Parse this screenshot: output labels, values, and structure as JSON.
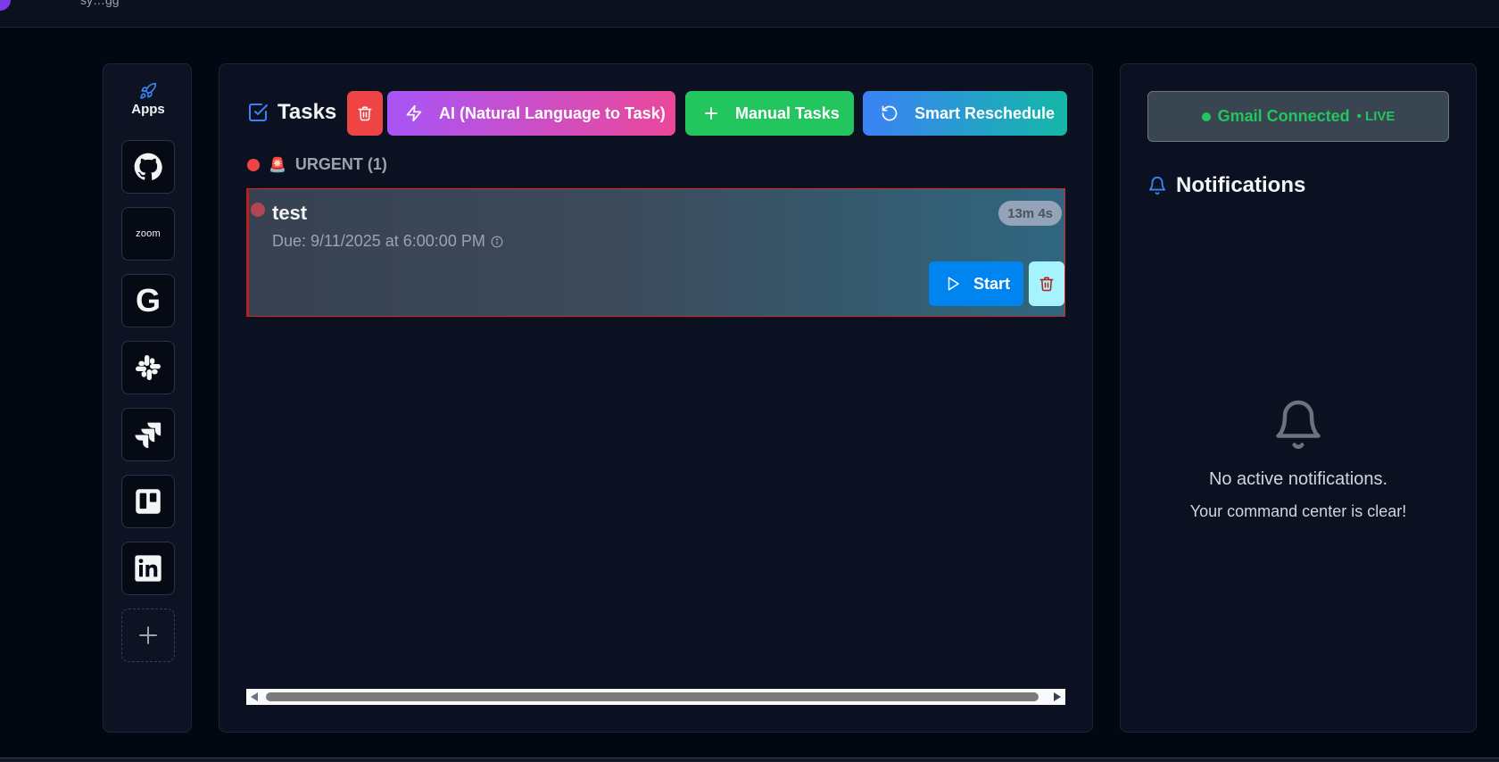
{
  "topbar": {
    "user_text": "sy…gg"
  },
  "sidebar": {
    "header_label": "Apps",
    "apps": [
      {
        "name": "github",
        "icon": "github-icon"
      },
      {
        "name": "zoom",
        "icon": "zoom-icon",
        "text": "zoom"
      },
      {
        "name": "google",
        "icon": "google-icon",
        "text": "G"
      },
      {
        "name": "slack",
        "icon": "slack-icon"
      },
      {
        "name": "jira",
        "icon": "jira-icon"
      },
      {
        "name": "trello",
        "icon": "trello-icon"
      },
      {
        "name": "linkedin",
        "icon": "linkedin-icon"
      }
    ],
    "add_icon": "plus-icon"
  },
  "tasks": {
    "title": "Tasks",
    "buttons": {
      "ai_label": "AI (Natural Language to Task)",
      "manual_label": "Manual Tasks",
      "smart_label": "Smart Reschedule"
    },
    "group": {
      "label": "URGENT (1)",
      "emoji": "🚨",
      "color": "#ef4444"
    },
    "items": [
      {
        "title": "test",
        "due": "Due: 9/11/2025 at 6:00:00 PM",
        "timer": "13m 4s",
        "start_label": "Start"
      }
    ]
  },
  "right": {
    "gmail": {
      "status": "Gmail Connected",
      "live": "• LIVE",
      "color": "#22c55e"
    },
    "notifications": {
      "title": "Notifications",
      "empty_title": "No active notifications.",
      "empty_subtitle": "Your command center is clear!"
    }
  },
  "colors": {
    "background": "#030712",
    "panel": "#0b1120",
    "danger": "#ef4444",
    "success": "#22c55e",
    "primary": "#0084f0"
  }
}
